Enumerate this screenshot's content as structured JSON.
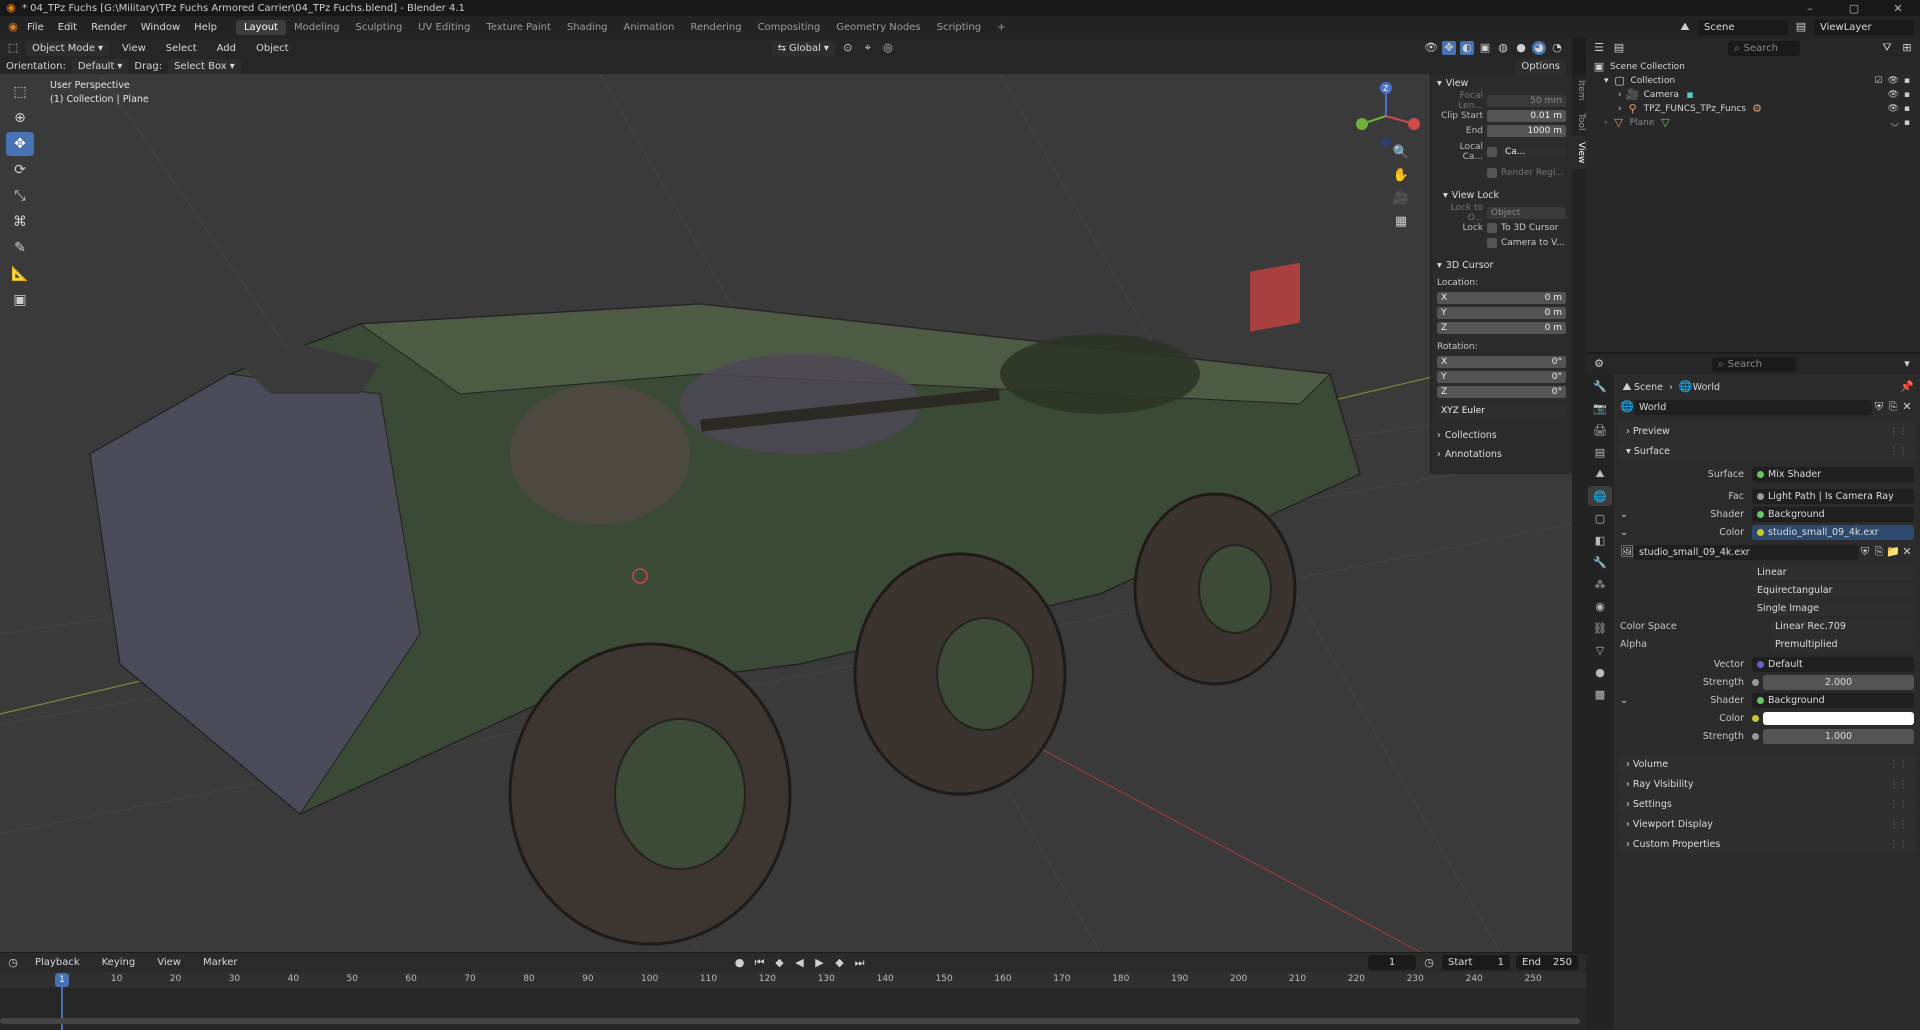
{
  "window": {
    "title": "* 04_TPz Fuchs [G:\\Military\\TPz Fuchs Armored Carrier\\04_TPz Fuchs.blend] - Blender 4.1",
    "controls": [
      "–",
      "▢",
      "✕"
    ]
  },
  "menu": [
    "File",
    "Edit",
    "Render",
    "Window",
    "Help"
  ],
  "workspaces": [
    "Layout",
    "Modeling",
    "Sculpting",
    "UV Editing",
    "Texture Paint",
    "Shading",
    "Animation",
    "Rendering",
    "Compositing",
    "Geometry Nodes",
    "Scripting"
  ],
  "scene_selector": {
    "label": "Scene",
    "viewlayer": "ViewLayer"
  },
  "viewport_header": {
    "mode": "Object Mode",
    "menus": [
      "View",
      "Select",
      "Add",
      "Object"
    ],
    "transform": "Global",
    "orientation_label": "Orientation:",
    "orientation_value": "Default",
    "drag_label": "Drag:",
    "drag_value": "Select Box",
    "options": "Options"
  },
  "viewport": {
    "perspective": "User Perspective",
    "collection": "(1) Collection | Plane"
  },
  "npanel": {
    "tabs": [
      "Item",
      "Tool",
      "View"
    ],
    "view_title": "View",
    "focal_label": "Focal Len...",
    "focal_value": "50 mm",
    "clip_start_label": "Clip Start",
    "clip_start_value": "0.01 m",
    "clip_end_label": "End",
    "clip_end_value": "1000 m",
    "local_camera_label": "Local Ca...",
    "local_camera_value": "Ca...",
    "render_region": "Render Regi...",
    "view_lock_title": "View Lock",
    "lock_to_label": "Lock to O...",
    "lock_to_value": "Object",
    "lock_label": "Lock",
    "lock_cursor": "To 3D Cursor",
    "lock_camera": "Camera to V...",
    "cursor_title": "3D Cursor",
    "location_label": "Location:",
    "location": [
      {
        "axis": "X",
        "value": "0 m"
      },
      {
        "axis": "Y",
        "value": "0 m"
      },
      {
        "axis": "Z",
        "value": "0 m"
      }
    ],
    "rotation_label": "Rotation:",
    "rotation": [
      {
        "axis": "X",
        "value": "0°"
      },
      {
        "axis": "Y",
        "value": "0°"
      },
      {
        "axis": "Z",
        "value": "0°"
      }
    ],
    "rotation_mode": "XYZ Euler",
    "collections": "Collections",
    "annotations": "Annotations"
  },
  "timeline": {
    "menus": [
      "Playback",
      "Keying",
      "View",
      "Marker"
    ],
    "current_frame": "1",
    "start_label": "Start",
    "start_value": "1",
    "end_label": "End",
    "end_value": "250",
    "ticks": [
      "1",
      "10",
      "20",
      "30",
      "40",
      "50",
      "60",
      "70",
      "80",
      "90",
      "100",
      "110",
      "120",
      "130",
      "140",
      "150",
      "160",
      "170",
      "180",
      "190",
      "200",
      "210",
      "220",
      "230",
      "240",
      "250"
    ]
  },
  "outliner": {
    "search_placeholder": "Search",
    "rows": [
      {
        "label": "Scene Collection",
        "indent": 0
      },
      {
        "label": "Collection",
        "indent": 1
      },
      {
        "label": "Camera",
        "indent": 2
      },
      {
        "label": "TPZ_FUNCS_TPz_Funcs",
        "indent": 2
      },
      {
        "label": "Plane",
        "indent": 1
      }
    ]
  },
  "properties": {
    "search_placeholder": "Search",
    "breadcrumb_scene": "Scene",
    "breadcrumb_world": "World",
    "world_name": "World",
    "sections_top": [
      "Preview",
      "Surface"
    ],
    "surface_label": "Surface",
    "surface_value": "Mix Shader",
    "fac_label": "Fac",
    "fac_value": "Light Path | Is Camera Ray",
    "shader1_label": "Shader",
    "shader1_value": "Background",
    "color1_label": "Color",
    "color1_value": "studio_small_09_4k.exr",
    "image_name": "studio_small_09_4k.exr",
    "interp": "Linear",
    "projection": "Equirectangular",
    "source": "Single Image",
    "colorspace_label": "Color Space",
    "colorspace_value": "Linear Rec.709",
    "alpha_label": "Alpha",
    "alpha_value": "Premultiplied",
    "vector_label": "Vector",
    "vector_value": "Default",
    "strength1_label": "Strength",
    "strength1_value": "2.000",
    "shader2_label": "Shader",
    "shader2_value": "Background",
    "color2_label": "Color",
    "strength2_label": "Strength",
    "strength2_value": "1.000",
    "sections_bottom": [
      "Volume",
      "Ray Visibility",
      "Settings",
      "Viewport Display",
      "Custom Properties"
    ]
  }
}
